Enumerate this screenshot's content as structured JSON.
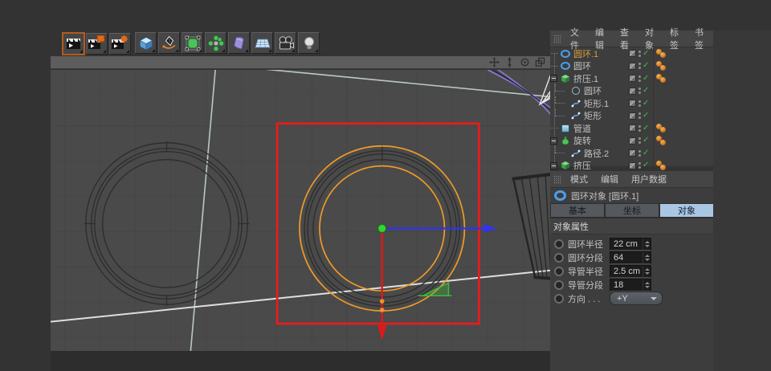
{
  "colors": {
    "selection_red": "#e81c1c",
    "wire_orange": "#ef9b27",
    "axis_blue": "#3333e8",
    "axis_red": "#e01818",
    "center_green": "#35d435",
    "selected_text_orange": "#d89a38",
    "tab_selected_blue": "#a9c6e4",
    "check_green": "#3fbf4a",
    "tag_orange": "#d07b1e"
  },
  "toolbar": {
    "render_buttons": [
      "render-view",
      "render-region",
      "render-settings"
    ],
    "tool_buttons": [
      "add-cube",
      "draw-spline",
      "subdivision-surface",
      "array",
      "deformer",
      "floor",
      "camera",
      "light"
    ]
  },
  "viewport": {
    "nav_icons": [
      "move-icon",
      "dolly-icon",
      "rotate-icon",
      "toggle-view-icon"
    ]
  },
  "object_manager": {
    "menu": [
      "文件",
      "编辑",
      "查看",
      "对象",
      "标签",
      "书签"
    ],
    "rows": [
      {
        "label": "圆环.1",
        "icon": "torus-icon",
        "selected": true,
        "tags": 2
      },
      {
        "label": "圆环",
        "icon": "torus-icon",
        "selected": false,
        "tags": 2
      },
      {
        "label": "挤压.1",
        "icon": "extrude-icon",
        "selected": false,
        "tags": 2
      },
      {
        "label": "圆环",
        "icon": "circle-spline-icon",
        "selected": false,
        "tags": 0
      },
      {
        "label": "矩形.1",
        "icon": "spline-icon",
        "selected": false,
        "tags": 0
      },
      {
        "label": "矩形",
        "icon": "spline-icon",
        "selected": false,
        "tags": 0
      },
      {
        "label": "管道",
        "icon": "tube-icon",
        "selected": false,
        "tags": 2
      },
      {
        "label": "旋转",
        "icon": "lathe-icon",
        "selected": false,
        "tags": 2
      },
      {
        "label": "路径.2",
        "icon": "spline-icon",
        "selected": false,
        "tags": 0
      },
      {
        "label": "挤压",
        "icon": "extrude-icon",
        "selected": false,
        "tags": 2
      }
    ]
  },
  "attribute_manager": {
    "menu": [
      "模式",
      "编辑",
      "用户数据"
    ],
    "object_title": "圆环对象 [圆环.1]",
    "tabs": [
      "基本",
      "坐标",
      "对象"
    ],
    "selected_tab": "对象",
    "section": "对象属性",
    "fields": [
      {
        "label": "圆环半径",
        "value": "22 cm",
        "control": "spinner"
      },
      {
        "label": "圆环分段",
        "value": "64",
        "control": "spinner"
      },
      {
        "label": "导管半径",
        "value": "2.5 cm",
        "control": "spinner"
      },
      {
        "label": "导管分段",
        "value": "18",
        "control": "spinner"
      },
      {
        "label": "方向 . . .",
        "value": "+Y",
        "control": "dropdown"
      }
    ]
  }
}
